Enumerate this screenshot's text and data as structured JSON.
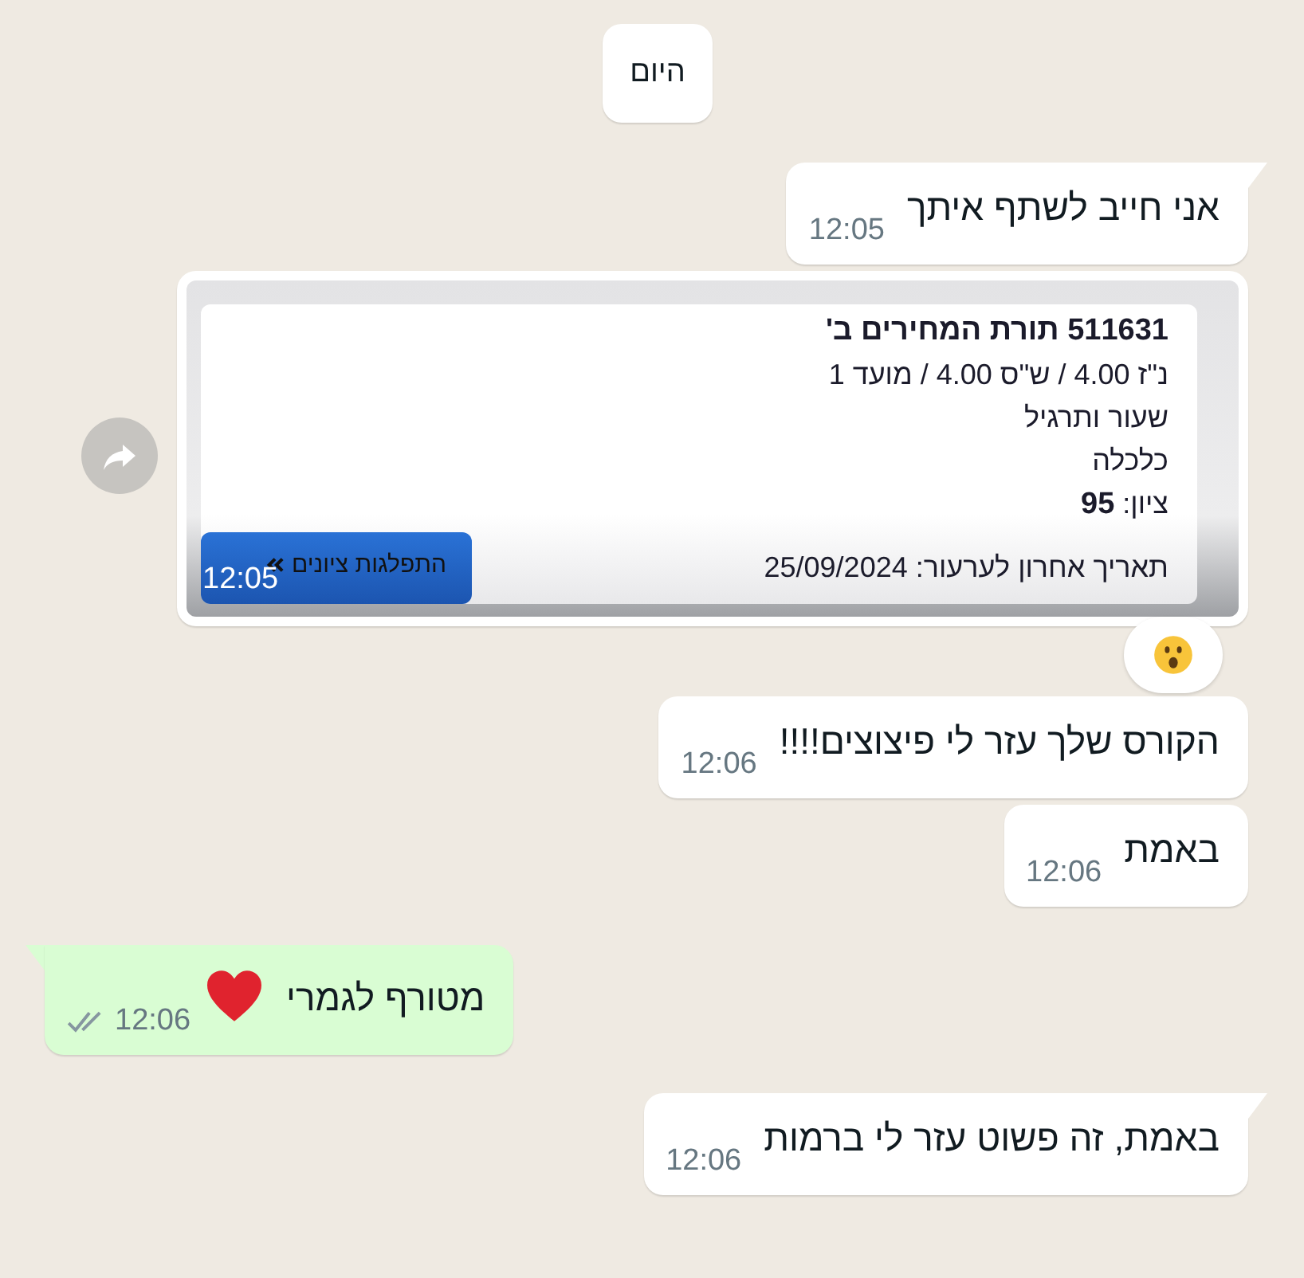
{
  "date_divider": "היום",
  "messages": [
    {
      "kind": "text",
      "outgoing": false,
      "tail": true,
      "text": "אני חייב לשתף איתך",
      "time": "12:05"
    },
    {
      "kind": "image",
      "outgoing": false,
      "time": "12:05",
      "forward_button": true,
      "reacted": true,
      "card": {
        "title": "511631 תורת המחירים ב'",
        "lines": [
          "נ\"ז 4.00 / ש\"ס 4.00 / מועד 1",
          "שעור ותרגיל",
          "כלכלה"
        ],
        "grade": "ציון: **95**",
        "appeal_date": "תאריך אחרון לערעור: 25/09/2024",
        "button": "התפלגות ציונים"
      }
    },
    {
      "kind": "text",
      "outgoing": false,
      "tail": false,
      "text": "הקורס שלך עזר לי פיצוצים!!!!",
      "time": "12:06"
    },
    {
      "kind": "text",
      "outgoing": false,
      "tail": false,
      "text": "באמת",
      "time": "12:06"
    },
    {
      "kind": "text",
      "outgoing": true,
      "tail": true,
      "text": "מטורף לגמרי",
      "heart": true,
      "time": "12:06",
      "ticks": true,
      "read": false
    },
    {
      "kind": "text",
      "outgoing": false,
      "tail": true,
      "text": "באמת, זה פשוט עזר לי ברמות",
      "time": "12:06"
    }
  ]
}
